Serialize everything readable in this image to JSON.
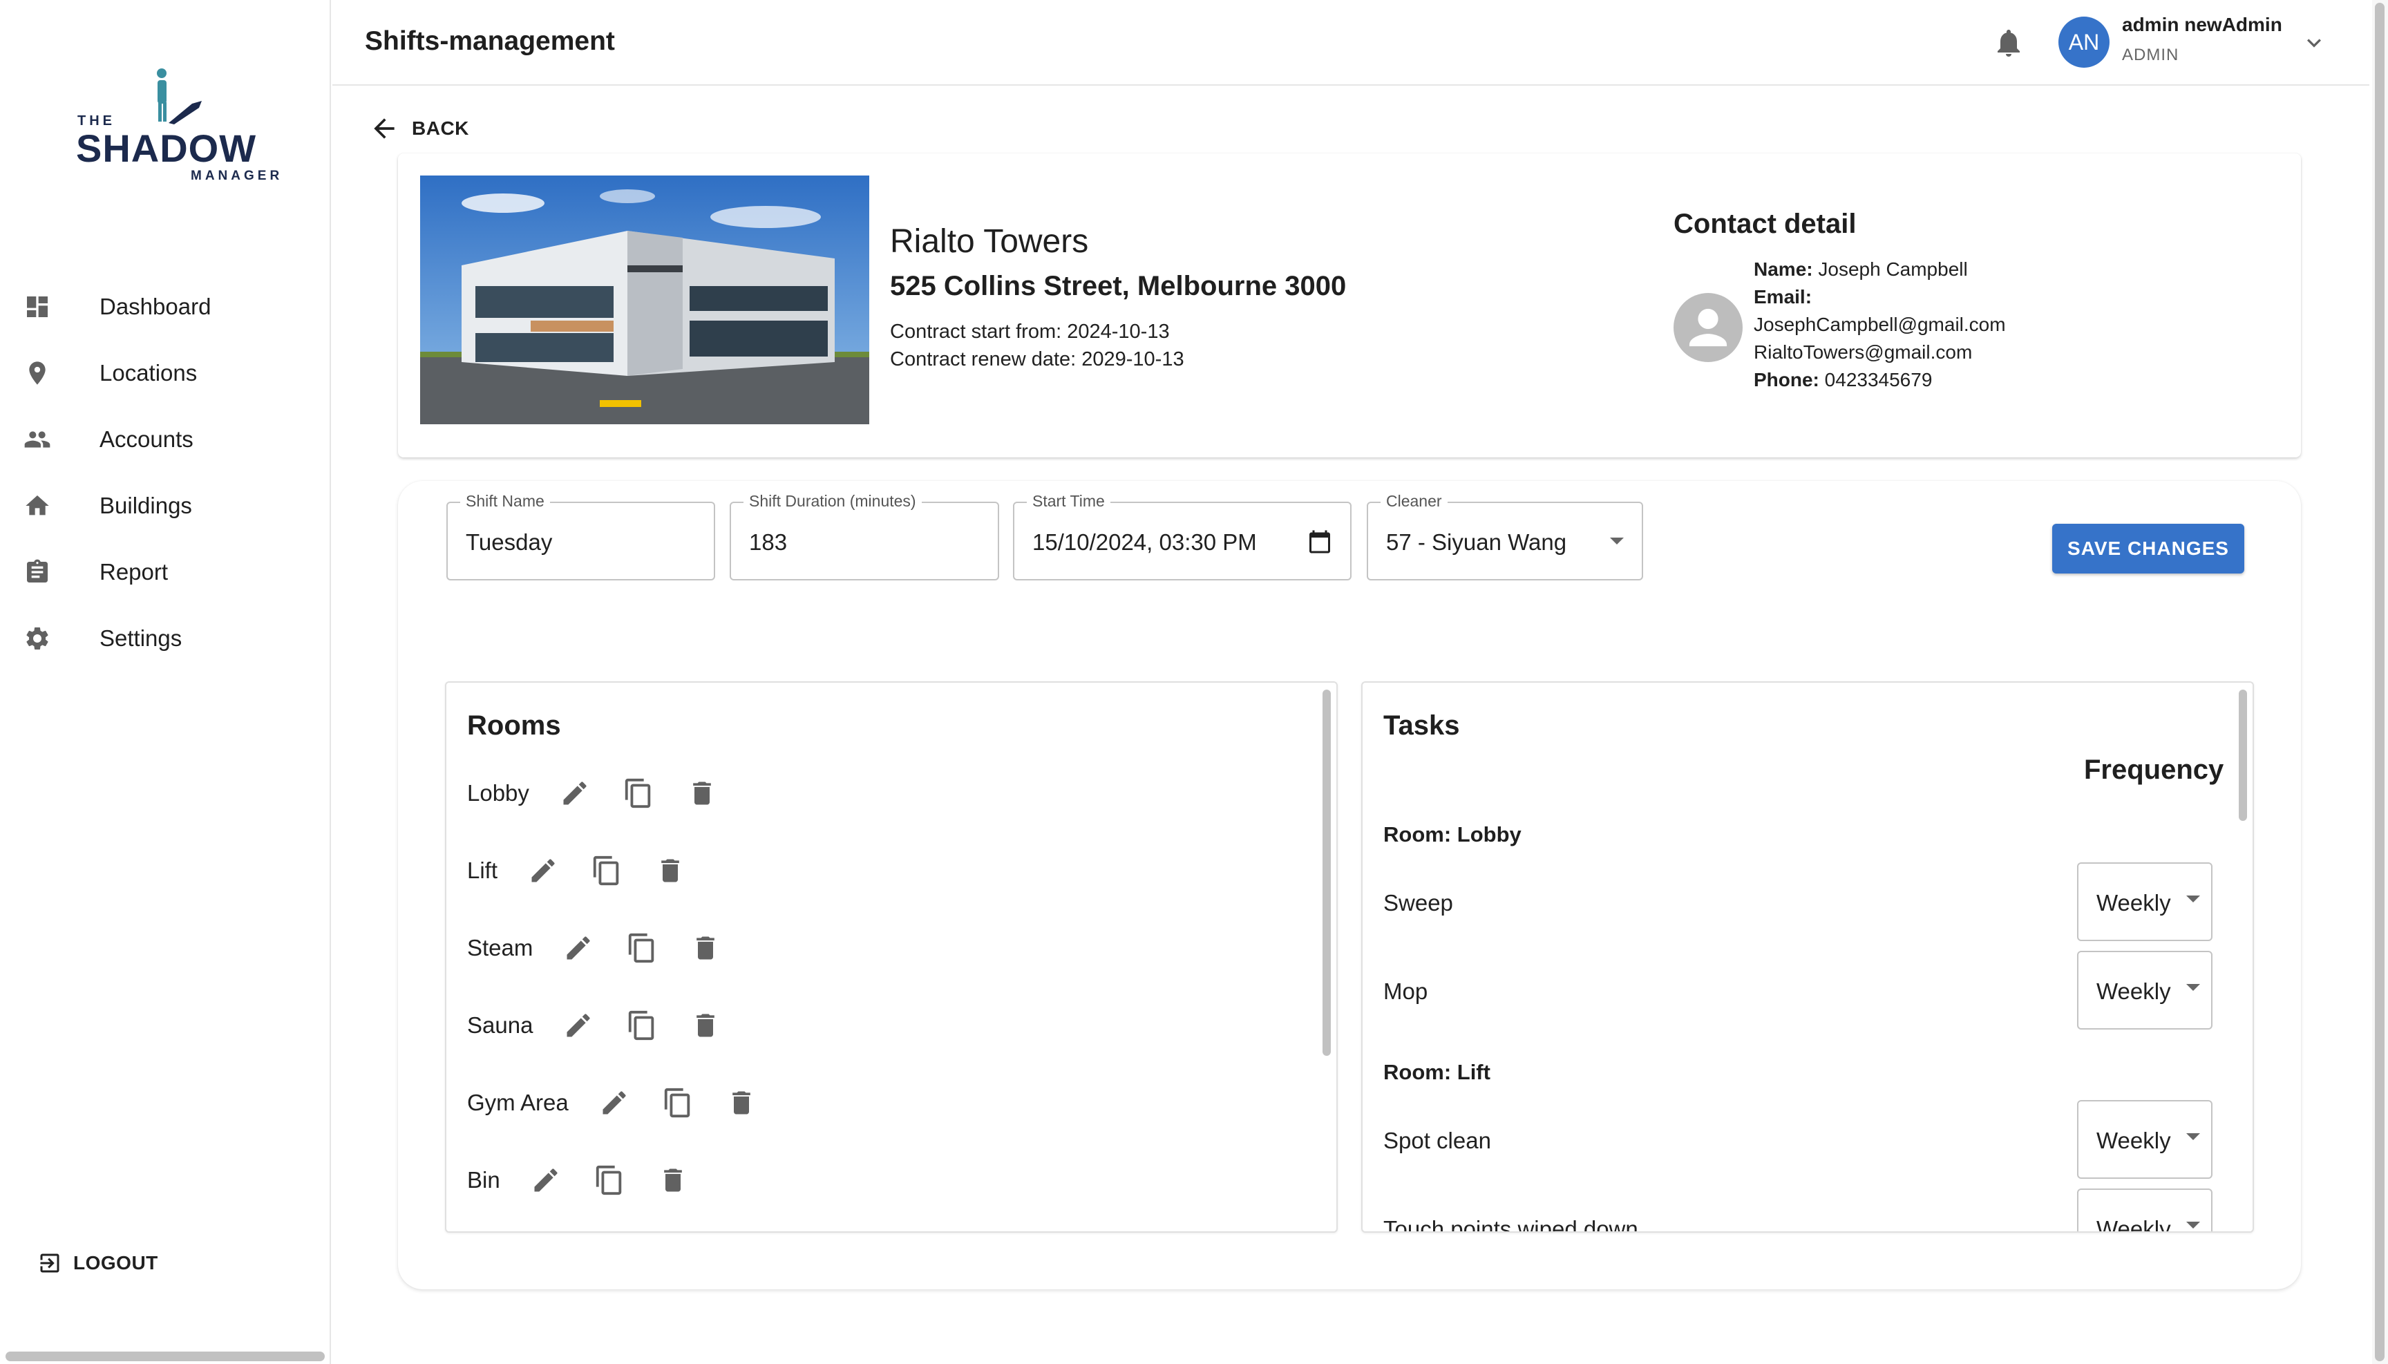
{
  "app": {
    "logo": {
      "the": "THE",
      "shadow": "SHADOW",
      "manager": "MANAGER"
    },
    "accent_color": "#3673c9"
  },
  "sidebar": {
    "items": [
      {
        "label": "Dashboard",
        "icon": "dashboard-icon"
      },
      {
        "label": "Locations",
        "icon": "location-pin-icon"
      },
      {
        "label": "Accounts",
        "icon": "people-icon"
      },
      {
        "label": "Buildings",
        "icon": "home-icon"
      },
      {
        "label": "Report",
        "icon": "clipboard-icon"
      },
      {
        "label": "Settings",
        "icon": "gear-icon"
      }
    ],
    "logout": "LOGOUT"
  },
  "header": {
    "title": "Shifts-management",
    "user": {
      "initials": "AN",
      "name": "admin newAdmin",
      "role": "ADMIN"
    }
  },
  "back_label": "BACK",
  "building": {
    "name": "Rialto Towers",
    "address": "525 Collins Street, Melbourne 3000",
    "contract_start": "Contract start from: 2024-10-13",
    "contract_renew": "Contract renew date: 2029-10-13"
  },
  "contact": {
    "title": "Contact detail",
    "name_label": "Name:",
    "name": "Joseph Campbell",
    "email_label": "Email:",
    "email1": "JosephCampbell@gmail.com",
    "email2": "RialtoTowers@gmail.com",
    "phone_label": "Phone:",
    "phone": "0423345679"
  },
  "form": {
    "shift_name_label": "Shift Name",
    "shift_name": "Tuesday",
    "duration_label": "Shift Duration (minutes)",
    "duration": "183",
    "start_label": "Start Time",
    "start": "15/10/2024, 03:30  PM",
    "cleaner_label": "Cleaner",
    "cleaner": "57 - Siyuan Wang",
    "save": "SAVE CHANGES"
  },
  "rooms": {
    "title": "Rooms",
    "items": [
      "Lobby",
      "Lift",
      "Steam",
      "Sauna",
      "Gym Area",
      "Bin"
    ]
  },
  "tasks": {
    "title": "Tasks",
    "frequency_header": "Frequency",
    "groups": [
      {
        "room": "Room: Lobby",
        "tasks": [
          {
            "name": "Sweep",
            "freq": "Weekly"
          },
          {
            "name": "Mop",
            "freq": "Weekly"
          }
        ]
      },
      {
        "room": "Room: Lift",
        "tasks": [
          {
            "name": "Spot clean",
            "freq": "Weekly"
          },
          {
            "name": "Touch points wiped down",
            "freq": "Weekly"
          }
        ]
      }
    ]
  }
}
